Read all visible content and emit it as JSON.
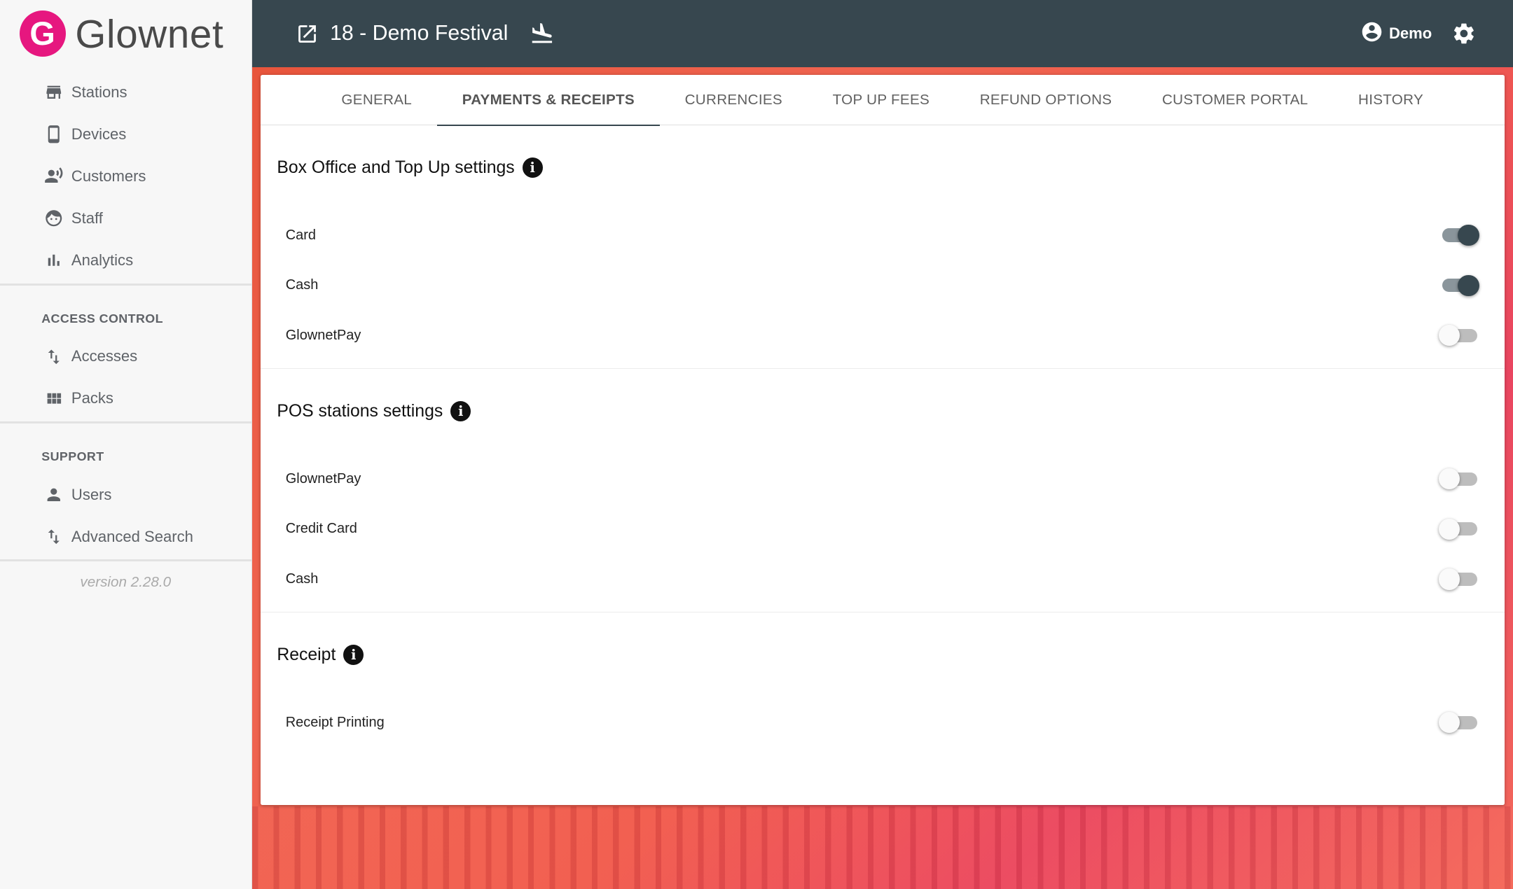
{
  "brand": {
    "logo_letter": "G",
    "name": "Glownet",
    "color": "#e6177f"
  },
  "sidebar": {
    "main_items": [
      {
        "label": "Stations",
        "icon": "store-icon"
      },
      {
        "label": "Devices",
        "icon": "smartphone-icon"
      },
      {
        "label": "Customers",
        "icon": "customer-voice-icon"
      },
      {
        "label": "Staff",
        "icon": "face-icon"
      },
      {
        "label": "Analytics",
        "icon": "bar-chart-icon"
      }
    ],
    "access_control": {
      "label": "ACCESS CONTROL",
      "items": [
        {
          "label": "Accesses",
          "icon": "arrows-up-down-icon"
        },
        {
          "label": "Packs",
          "icon": "grid-icon"
        }
      ]
    },
    "support": {
      "label": "SUPPORT",
      "items": [
        {
          "label": "Users",
          "icon": "person-icon"
        },
        {
          "label": "Advanced Search",
          "icon": "arrows-up-down-icon"
        }
      ]
    },
    "version": "version 2.28.0"
  },
  "header": {
    "title": "18 - Demo Festival",
    "user": "Demo"
  },
  "tabs": [
    {
      "label": "GENERAL",
      "active": false
    },
    {
      "label": "PAYMENTS & RECEIPTS",
      "active": true
    },
    {
      "label": "CURRENCIES",
      "active": false
    },
    {
      "label": "TOP UP FEES",
      "active": false
    },
    {
      "label": "REFUND OPTIONS",
      "active": false
    },
    {
      "label": "CUSTOMER PORTAL",
      "active": false
    },
    {
      "label": "HISTORY",
      "active": false
    }
  ],
  "sections": [
    {
      "title": "Box Office and Top Up settings",
      "rows": [
        {
          "label": "Card",
          "enabled": true
        },
        {
          "label": "Cash",
          "enabled": true
        },
        {
          "label": "GlownetPay",
          "enabled": false
        }
      ]
    },
    {
      "title": "POS stations settings",
      "rows": [
        {
          "label": "GlownetPay",
          "enabled": false
        },
        {
          "label": "Credit Card",
          "enabled": false
        },
        {
          "label": "Cash",
          "enabled": false
        }
      ]
    },
    {
      "title": "Receipt",
      "rows": [
        {
          "label": "Receipt Printing",
          "enabled": false
        }
      ]
    }
  ],
  "colors": {
    "header_bg": "#37474f",
    "toggle_on": "#37474f",
    "toggle_off": "#bdbdbd"
  }
}
